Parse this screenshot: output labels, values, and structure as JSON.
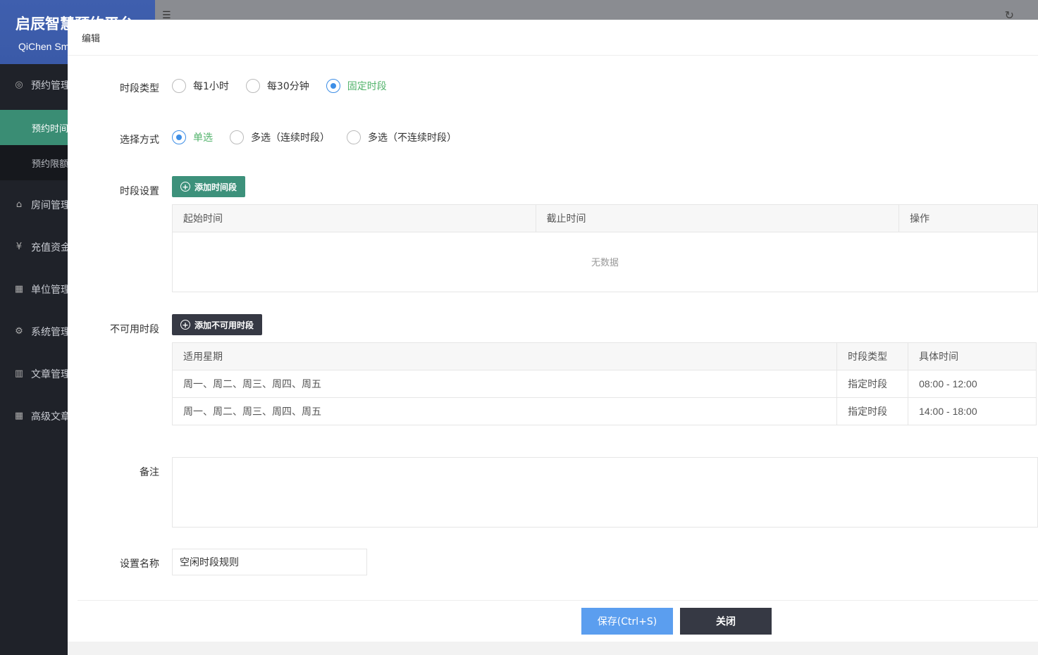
{
  "app": {
    "title": "启辰智慧预约平台",
    "subtitle": "QiChen Smart",
    "menu": [
      {
        "label": "预约管理",
        "icon": "eye-icon"
      },
      {
        "label": "房间管理",
        "icon": "home-icon"
      },
      {
        "label": "充值资金",
        "icon": "yen-icon"
      },
      {
        "label": "单位管理",
        "icon": "building-icon"
      },
      {
        "label": "系统管理",
        "icon": "gear-icon"
      },
      {
        "label": "文章管理",
        "icon": "book-icon"
      },
      {
        "label": "高级文章",
        "icon": "building-icon"
      }
    ],
    "submenu": [
      {
        "label": "预约时间"
      },
      {
        "label": "预约限额"
      }
    ]
  },
  "modal": {
    "title": "编辑",
    "period_type": {
      "label": "时段类型",
      "options": [
        "每1小时",
        "每30分钟",
        "固定时段"
      ],
      "selected": "固定时段"
    },
    "select_mode": {
      "label": "选择方式",
      "options": [
        "单选",
        "多选（连续时段）",
        "多选（不连续时段）"
      ],
      "selected": "单选"
    },
    "period_setting": {
      "label": "时段设置",
      "add_button": "添加时间段",
      "columns": [
        "起始时间",
        "截止时间",
        "操作"
      ],
      "empty_text": "无数据"
    },
    "unavailable": {
      "label": "不可用时段",
      "add_button": "添加不可用时段",
      "columns": [
        "适用星期",
        "时段类型",
        "具体时间"
      ],
      "rows": [
        {
          "weekdays": "周一、周二、周三、周四、周五",
          "type": "指定时段",
          "time": "08:00 - 12:00"
        },
        {
          "weekdays": "周一、周二、周三、周四、周五",
          "type": "指定时段",
          "time": "14:00 - 18:00"
        }
      ]
    },
    "remark": {
      "label": "备注",
      "value": ""
    },
    "name": {
      "label": "设置名称",
      "value": "空闲时段规则"
    },
    "save_button": "保存(Ctrl+S)",
    "close_button": "关闭"
  },
  "colors": {
    "accent_green": "#3d917b",
    "radio_blue": "#3d8ee6",
    "save_blue": "#5b9eef",
    "dark_button": "#363944"
  }
}
